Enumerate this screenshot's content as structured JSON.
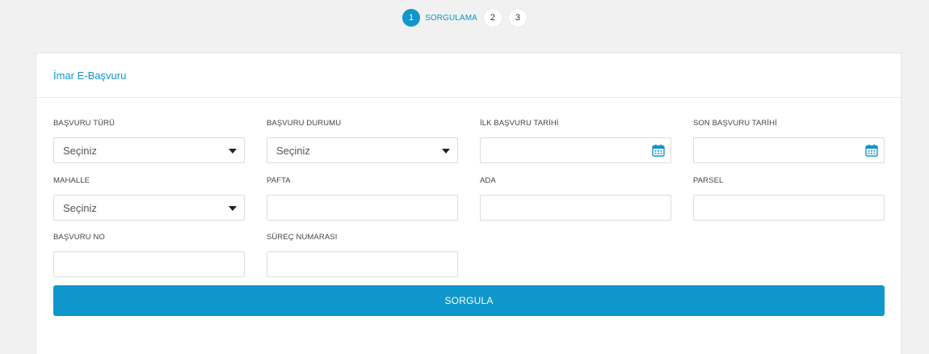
{
  "stepper": {
    "steps": [
      {
        "number": "1",
        "label": "SORGULAMA",
        "active": true
      },
      {
        "number": "2"
      },
      {
        "number": "3"
      }
    ]
  },
  "card": {
    "title": "İmar E-Başvuru"
  },
  "form": {
    "basvuru_turu": {
      "label": "BAŞVURU TÜRÜ",
      "value": "Seçiniz"
    },
    "basvuru_durumu": {
      "label": "BAŞVURU DURUMU",
      "value": "Seçiniz"
    },
    "ilk_basvuru_tarihi": {
      "label": "İLK BAŞVURU TARİHİ",
      "value": ""
    },
    "son_basvuru_tarihi": {
      "label": "SON BAŞVURU TARİHİ",
      "value": ""
    },
    "mahalle": {
      "label": "MAHALLE",
      "value": "Seçiniz"
    },
    "pafta": {
      "label": "PAFTA",
      "value": ""
    },
    "ada": {
      "label": "ADA",
      "value": ""
    },
    "parsel": {
      "label": "PARSEL",
      "value": ""
    },
    "basvuru_no": {
      "label": "BAŞVURU NO",
      "value": ""
    },
    "surec_numarasi": {
      "label": "SÜREÇ NUMARASI",
      "value": ""
    },
    "submit_label": "SORGULA"
  },
  "colors": {
    "accent": "#1295c9",
    "button": "#0f97cc",
    "background": "#f1f1f1"
  },
  "icons": {
    "date_picker": "calendar-icon",
    "dropdown": "chevron-down-icon"
  }
}
